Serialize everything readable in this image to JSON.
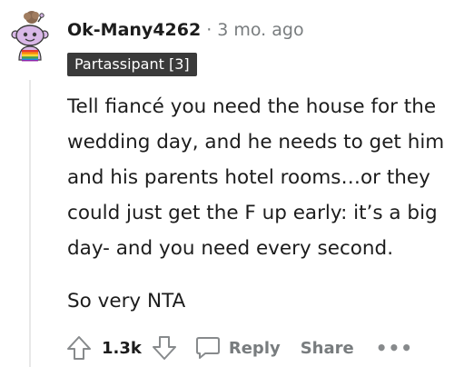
{
  "comment": {
    "username": "Ok-Many4262",
    "separator": "·",
    "timestamp": "3 mo. ago",
    "flair": "Partassipant [3]",
    "body": [
      "Tell fiancé you need the house for the wedding day, and he needs to get him and his parents hotel rooms…or they could just get the F up early: it’s a big day- and you need every second.",
      "So very NTA"
    ]
  },
  "actions": {
    "upvote_icon": "upvote-arrow-icon",
    "score": "1.3k",
    "downvote_icon": "downvote-arrow-icon",
    "reply_icon": "speech-bubble-icon",
    "reply_label": "Reply",
    "share_label": "Share",
    "more_label": "•••"
  },
  "colors": {
    "text_primary": "#1c1c1c",
    "text_muted": "#787c7e",
    "flair_bg": "#3a3a3a",
    "flair_text": "#ffffff",
    "thread_line": "#e8e8e8"
  }
}
